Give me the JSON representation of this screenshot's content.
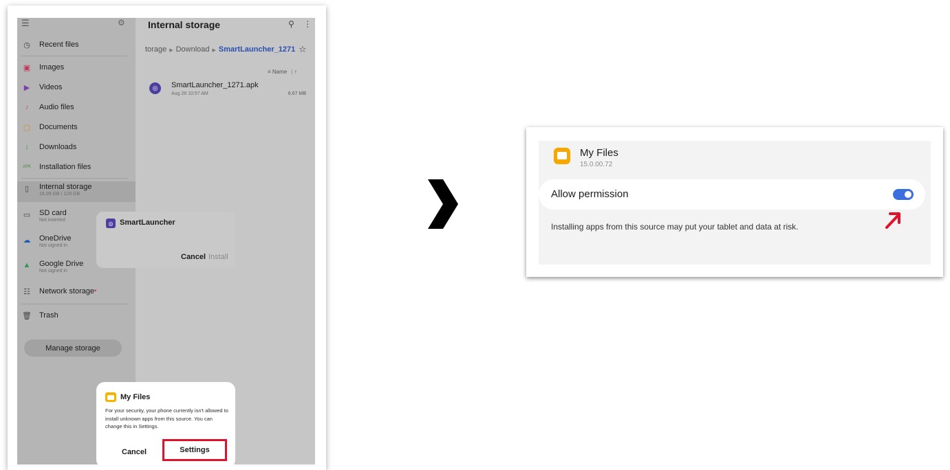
{
  "left": {
    "sidebar": {
      "items": [
        {
          "label": "Recent files",
          "icon": "clock-icon"
        },
        {
          "label": "Images",
          "icon": "image-icon"
        },
        {
          "label": "Videos",
          "icon": "video-icon"
        },
        {
          "label": "Audio files",
          "icon": "music-icon"
        },
        {
          "label": "Documents",
          "icon": "document-icon"
        },
        {
          "label": "Downloads",
          "icon": "download-icon"
        },
        {
          "label": "Installation files",
          "icon": "apk-icon"
        },
        {
          "label": "Internal storage",
          "sub": "16.09 GB / 128 GB",
          "icon": "phone-icon"
        },
        {
          "label": "SD card",
          "sub": "Not inserted",
          "icon": "sdcard-icon"
        },
        {
          "label": "OneDrive",
          "sub": "Not signed in",
          "icon": "onedrive-icon"
        },
        {
          "label": "Google Drive",
          "sub": "Not signed in",
          "icon": "google-drive-icon"
        },
        {
          "label": "Network storage",
          "icon": "network-storage-icon"
        },
        {
          "label": "Trash",
          "icon": "trash-icon"
        }
      ],
      "manage_label": "Manage storage"
    },
    "header": {
      "title": "Internal storage"
    },
    "breadcrumb": {
      "part1": "torage",
      "part2": "Download",
      "current": "SmartLauncher_1271"
    },
    "sort_label": "Name",
    "file": {
      "name": "SmartLauncher_1271.apk",
      "date": "Aug 28 10:57 AM",
      "size": "6.67 MB"
    },
    "install_dialog": {
      "title": "SmartLauncher",
      "cancel": "Cancel",
      "install": "Install"
    },
    "security_dialog": {
      "title": "My Files",
      "message": "For your security, your phone currently isn't allowed to install unknown apps from this source. You can change this in Settings.",
      "cancel": "Cancel",
      "settings": "Settings",
      "highlight_color": "#e0112b"
    }
  },
  "right": {
    "app_name": "My Files",
    "version": "15.0.00.72",
    "permission_label": "Allow permission",
    "permission_enabled": true,
    "risk_text": "Installing apps from this source may put your tablet and data at risk.",
    "toggle_color": "#3d6ee0",
    "arrow_color": "#e0112b"
  }
}
